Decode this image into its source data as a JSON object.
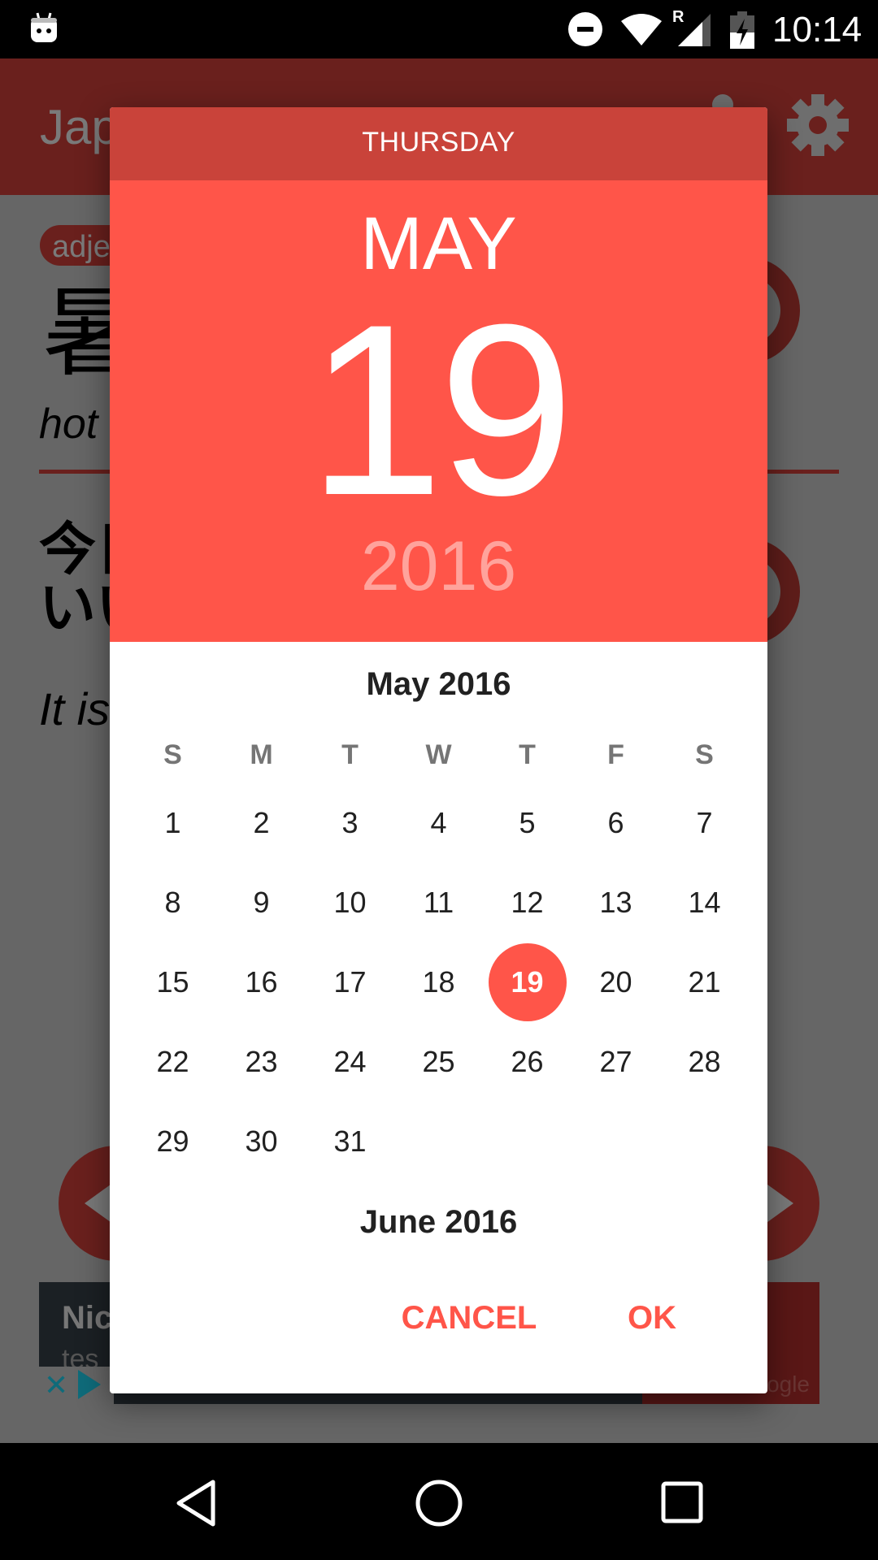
{
  "status_bar": {
    "time": "10:14",
    "roaming_label": "R",
    "icons": [
      "android-notification-icon",
      "do-not-disturb-icon",
      "wifi-icon",
      "cell-signal-icon",
      "battery-charging-icon"
    ]
  },
  "app": {
    "title": "Jap",
    "toolbar_icons": [
      "more-options-icon",
      "settings-gear-icon"
    ],
    "word_type": "adje",
    "word_kanji": "暑",
    "word_meaning": "hot",
    "sentence_lines": [
      "今日",
      "いい"
    ],
    "sentence_translation": "It is",
    "ad": {
      "title": "Nic",
      "subtitle": "tes",
      "attribution": "ogle"
    }
  },
  "date_picker": {
    "weekday_header": "THURSDAY",
    "selected_month": "MAY",
    "selected_day": "19",
    "selected_year": "2016",
    "accent_color": "#FF5549",
    "header_dark_color": "#C9433A",
    "current_month_title": "May 2016",
    "weekdays": [
      "S",
      "M",
      "T",
      "W",
      "T",
      "F",
      "S"
    ],
    "first_weekday_index": 0,
    "days": [
      "1",
      "2",
      "3",
      "4",
      "5",
      "6",
      "7",
      "8",
      "9",
      "10",
      "11",
      "12",
      "13",
      "14",
      "15",
      "16",
      "17",
      "18",
      "19",
      "20",
      "21",
      "22",
      "23",
      "24",
      "25",
      "26",
      "27",
      "28",
      "29",
      "30",
      "31"
    ],
    "selected_day_value": "19",
    "next_month_title": "June 2016",
    "cancel_label": "CANCEL",
    "ok_label": "OK"
  }
}
